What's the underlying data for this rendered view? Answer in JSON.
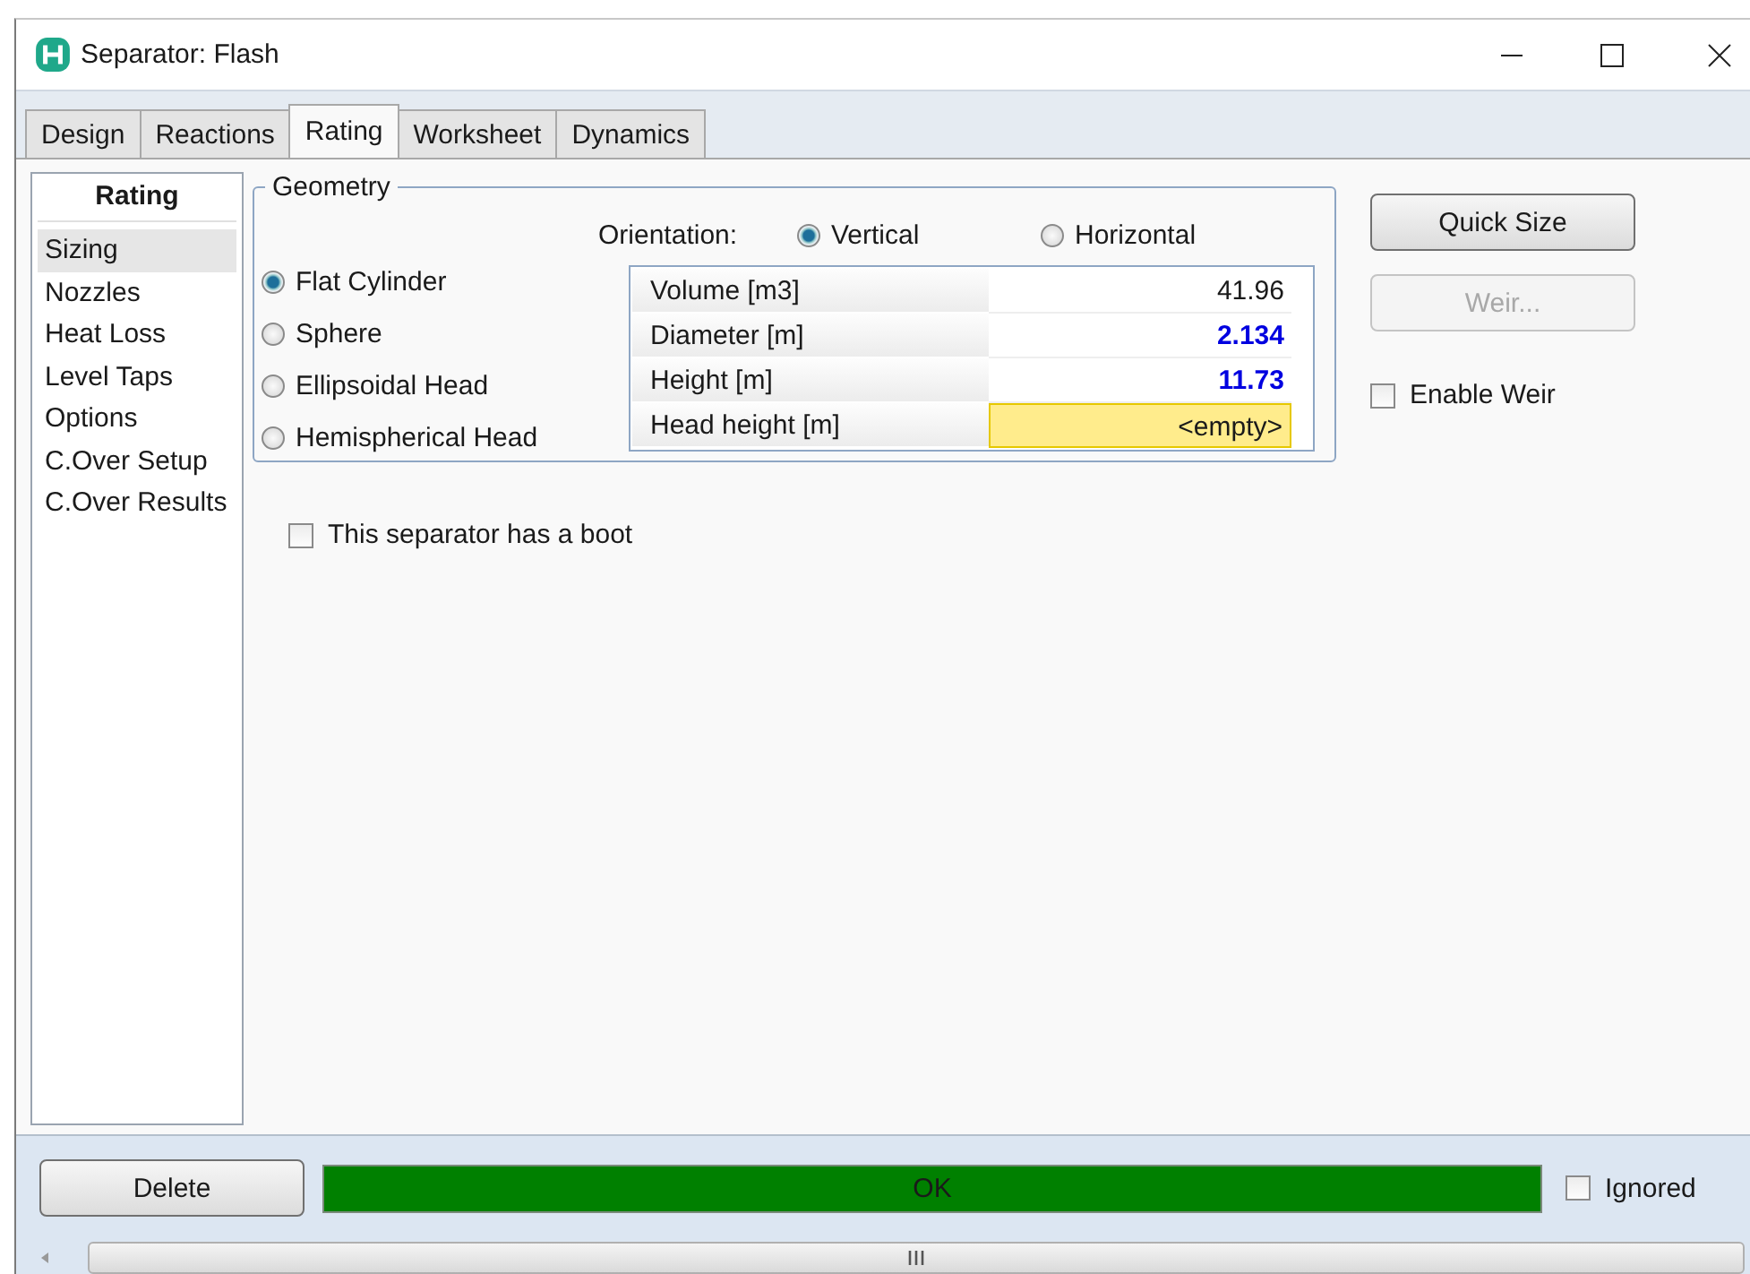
{
  "window": {
    "title": "Separator: Flash"
  },
  "tabs": [
    {
      "label": "Design",
      "selected": false
    },
    {
      "label": "Reactions",
      "selected": false
    },
    {
      "label": "Rating",
      "selected": true
    },
    {
      "label": "Worksheet",
      "selected": false
    },
    {
      "label": "Dynamics",
      "selected": false
    }
  ],
  "sidebar": {
    "header": "Rating",
    "items": [
      {
        "label": "Sizing",
        "selected": true
      },
      {
        "label": "Nozzles",
        "selected": false
      },
      {
        "label": "Heat Loss",
        "selected": false
      },
      {
        "label": "Level Taps",
        "selected": false
      },
      {
        "label": "Options",
        "selected": false
      },
      {
        "label": "C.Over Setup",
        "selected": false
      },
      {
        "label": "C.Over Results",
        "selected": false
      }
    ]
  },
  "geometry": {
    "legend": "Geometry",
    "shapes": [
      {
        "label": "Flat Cylinder",
        "selected": true
      },
      {
        "label": "Sphere",
        "selected": false
      },
      {
        "label": "Ellipsoidal Head",
        "selected": false
      },
      {
        "label": "Hemispherical Head",
        "selected": false
      }
    ],
    "orientation": {
      "label": "Orientation:",
      "options": [
        {
          "label": "Vertical",
          "selected": true
        },
        {
          "label": "Horizontal",
          "selected": false
        }
      ]
    },
    "table": [
      {
        "label": "Volume [m3]",
        "value": "41.96",
        "kind": "calculated"
      },
      {
        "label": "Diameter [m]",
        "value": "2.134",
        "kind": "specified"
      },
      {
        "label": "Height [m]",
        "value": "11.73",
        "kind": "specified"
      },
      {
        "label": "Head height [m]",
        "value": "<empty>",
        "kind": "empty"
      }
    ]
  },
  "boot_checkbox": {
    "label": "This separator has a boot",
    "checked": false
  },
  "side_buttons": [
    {
      "label": "Quick Size",
      "disabled": false
    },
    {
      "label": "Weir...",
      "disabled": true
    }
  ],
  "enable_weir": {
    "label": "Enable Weir",
    "checked": false
  },
  "footer": {
    "delete_button": "Delete",
    "status": {
      "text": "OK",
      "color": "#008000"
    },
    "ignored": {
      "label": "Ignored",
      "checked": false
    }
  }
}
